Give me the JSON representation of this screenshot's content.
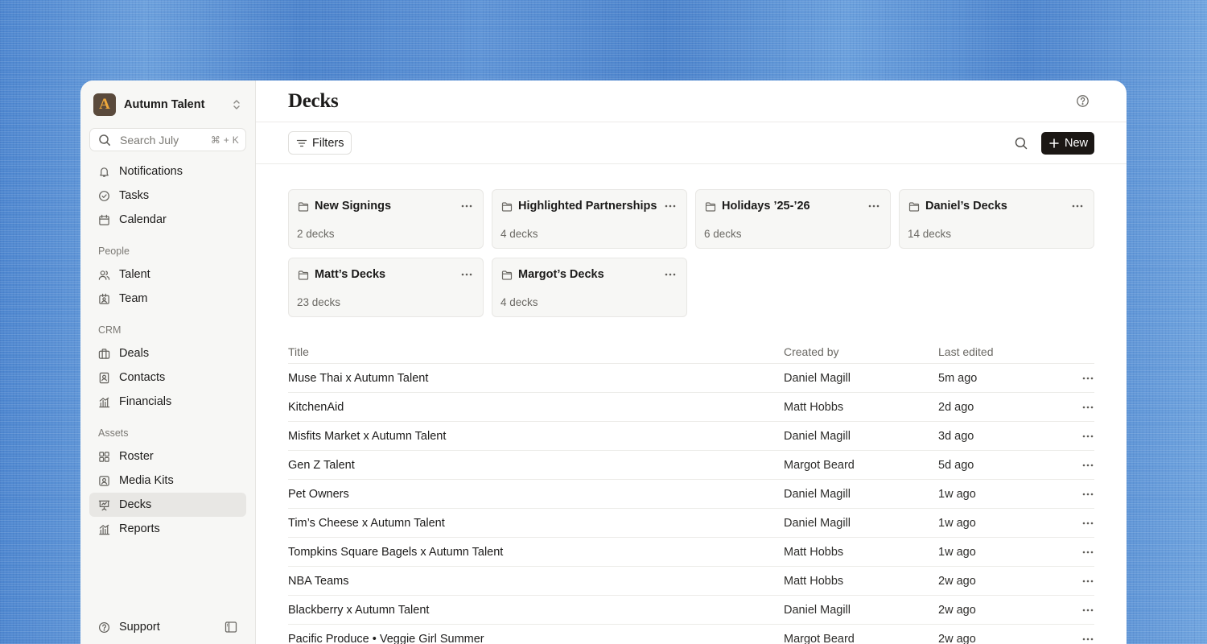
{
  "workspace": {
    "logo_letter": "A",
    "name": "Autumn Talent",
    "chevron_icon": "chevron-up-down-icon"
  },
  "search": {
    "placeholder": "Search July",
    "shortcut": "⌘ + K"
  },
  "sidebar": {
    "top_items": [
      {
        "label": "Notifications",
        "icon": "bell-icon"
      },
      {
        "label": "Tasks",
        "icon": "check-circle-icon"
      },
      {
        "label": "Calendar",
        "icon": "calendar-icon"
      }
    ],
    "sections": [
      {
        "title": "People",
        "items": [
          {
            "label": "Talent",
            "icon": "users-icon"
          },
          {
            "label": "Team",
            "icon": "id-badge-icon"
          }
        ]
      },
      {
        "title": "CRM",
        "items": [
          {
            "label": "Deals",
            "icon": "briefcase-icon"
          },
          {
            "label": "Contacts",
            "icon": "contact-card-icon"
          },
          {
            "label": "Financials",
            "icon": "bar-chart-icon"
          }
        ]
      },
      {
        "title": "Assets",
        "items": [
          {
            "label": "Roster",
            "icon": "grid-icon"
          },
          {
            "label": "Media Kits",
            "icon": "media-kit-icon"
          },
          {
            "label": "Decks",
            "icon": "presentation-icon",
            "active": true
          },
          {
            "label": "Reports",
            "icon": "bar-chart-icon"
          }
        ]
      }
    ],
    "footer": {
      "label": "Support",
      "icon": "help-circle-icon",
      "collapse_icon": "sidebar-toggle-icon"
    }
  },
  "page": {
    "title": "Decks",
    "help_icon": "help-circle-icon"
  },
  "toolbar": {
    "filters_label": "Filters",
    "new_label": "New"
  },
  "folders": [
    {
      "name": "New Signings",
      "count": "2 decks"
    },
    {
      "name": "Highlighted Partnerships",
      "count": "4 decks"
    },
    {
      "name": "Holidays ’25-’26",
      "count": "6 decks"
    },
    {
      "name": "Daniel’s Decks",
      "count": "14 decks"
    },
    {
      "name": "Matt’s Decks",
      "count": "23 decks"
    },
    {
      "name": "Margot’s Decks",
      "count": "4 decks"
    }
  ],
  "table": {
    "headers": {
      "title": "Title",
      "created_by": "Created by",
      "last_edited": "Last edited"
    },
    "rows": [
      {
        "title": "Muse Thai x Autumn Talent",
        "created_by": "Daniel Magill",
        "last_edited": "5m ago"
      },
      {
        "title": "KitchenAid",
        "created_by": "Matt Hobbs",
        "last_edited": "2d ago"
      },
      {
        "title": "Misfits Market x Autumn Talent",
        "created_by": "Daniel Magill",
        "last_edited": "3d ago"
      },
      {
        "title": "Gen Z Talent",
        "created_by": "Margot Beard",
        "last_edited": "5d ago"
      },
      {
        "title": "Pet Owners",
        "created_by": "Daniel Magill",
        "last_edited": "1w ago"
      },
      {
        "title": "Tim’s Cheese x Autumn Talent",
        "created_by": "Daniel Magill",
        "last_edited": "1w ago"
      },
      {
        "title": "Tompkins Square Bagels x Autumn Talent",
        "created_by": "Matt Hobbs",
        "last_edited": "1w ago"
      },
      {
        "title": "NBA Teams",
        "created_by": "Matt Hobbs",
        "last_edited": "2w ago"
      },
      {
        "title": "Blackberry x Autumn Talent",
        "created_by": "Daniel Magill",
        "last_edited": "2w ago"
      },
      {
        "title": "Pacific Produce • Veggie Girl Summer",
        "created_by": "Margot Beard",
        "last_edited": "2w ago"
      }
    ]
  }
}
